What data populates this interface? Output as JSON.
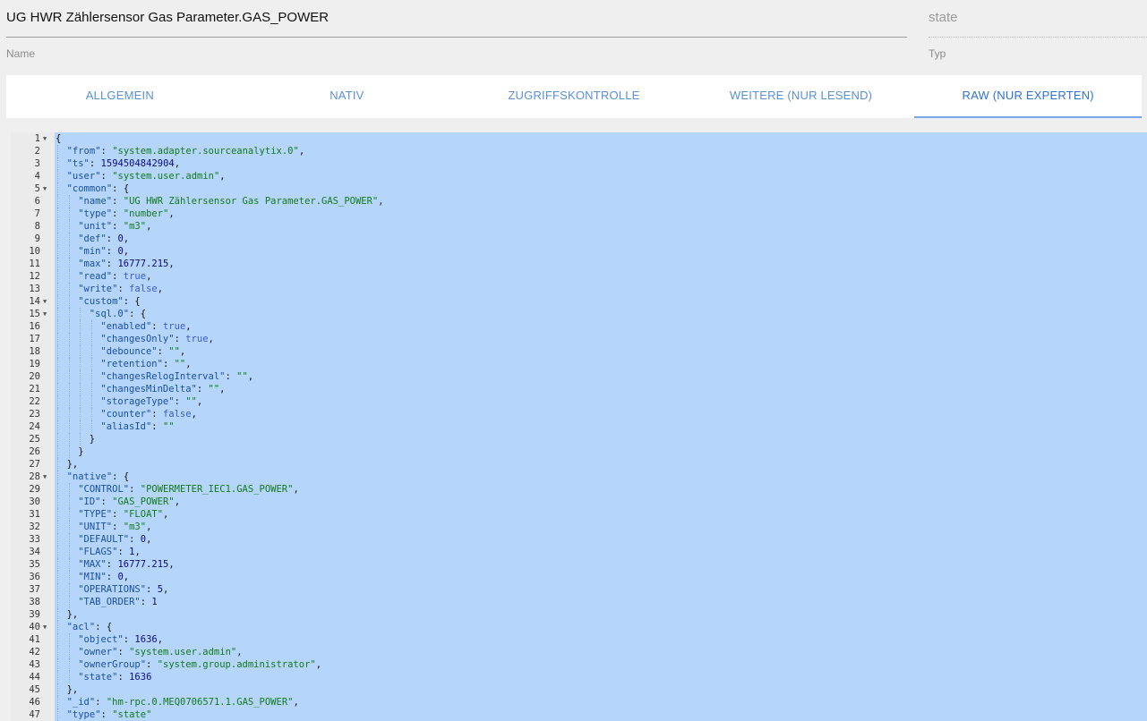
{
  "header": {
    "name_value": "UG HWR Zählersensor Gas Parameter.GAS_POWER",
    "name_label": "Name",
    "type_value": "state",
    "type_label": "Typ"
  },
  "tabs": [
    {
      "label": "ALLGEMEIN",
      "active": false
    },
    {
      "label": "NATIV",
      "active": false
    },
    {
      "label": "ZUGRIFFSKONTROLLE",
      "active": false
    },
    {
      "label": "WEITERE (NUR LESEND)",
      "active": false
    },
    {
      "label": "RAW (NUR EXPERTEN)",
      "active": true
    }
  ],
  "colors": {
    "selection": "#b5d5fb",
    "tab_text": "#5b8fd6",
    "tab_active_underline": "#7aa7e6",
    "json_key": "#1a4fa0",
    "json_string": "#117a1d",
    "json_number": "#0b0b84",
    "json_boolean": "#3a5bd6"
  },
  "editor": {
    "lines": [
      {
        "n": 1,
        "indent": 0,
        "fold": true,
        "t": [
          [
            "p",
            "{"
          ]
        ]
      },
      {
        "n": 2,
        "indent": 1,
        "t": [
          [
            "k",
            "\"from\""
          ],
          [
            "p",
            ": "
          ],
          [
            "s",
            "\"system.adapter.sourceanalytix.0\""
          ],
          [
            "p",
            ","
          ]
        ]
      },
      {
        "n": 3,
        "indent": 1,
        "t": [
          [
            "k",
            "\"ts\""
          ],
          [
            "p",
            ": "
          ],
          [
            "n",
            "1594504842904"
          ],
          [
            "p",
            ","
          ]
        ]
      },
      {
        "n": 4,
        "indent": 1,
        "t": [
          [
            "k",
            "\"user\""
          ],
          [
            "p",
            ": "
          ],
          [
            "s",
            "\"system.user.admin\""
          ],
          [
            "p",
            ","
          ]
        ]
      },
      {
        "n": 5,
        "indent": 1,
        "fold": true,
        "t": [
          [
            "k",
            "\"common\""
          ],
          [
            "p",
            ": {"
          ]
        ]
      },
      {
        "n": 6,
        "indent": 2,
        "t": [
          [
            "k",
            "\"name\""
          ],
          [
            "p",
            ": "
          ],
          [
            "s",
            "\"UG HWR Zählersensor Gas Parameter.GAS_POWER\""
          ],
          [
            "p",
            ","
          ]
        ]
      },
      {
        "n": 7,
        "indent": 2,
        "t": [
          [
            "k",
            "\"type\""
          ],
          [
            "p",
            ": "
          ],
          [
            "s",
            "\"number\""
          ],
          [
            "p",
            ","
          ]
        ]
      },
      {
        "n": 8,
        "indent": 2,
        "t": [
          [
            "k",
            "\"unit\""
          ],
          [
            "p",
            ": "
          ],
          [
            "s",
            "\"m3\""
          ],
          [
            "p",
            ","
          ]
        ]
      },
      {
        "n": 9,
        "indent": 2,
        "t": [
          [
            "k",
            "\"def\""
          ],
          [
            "p",
            ": "
          ],
          [
            "n",
            "0"
          ],
          [
            "p",
            ","
          ]
        ]
      },
      {
        "n": 10,
        "indent": 2,
        "t": [
          [
            "k",
            "\"min\""
          ],
          [
            "p",
            ": "
          ],
          [
            "n",
            "0"
          ],
          [
            "p",
            ","
          ]
        ]
      },
      {
        "n": 11,
        "indent": 2,
        "t": [
          [
            "k",
            "\"max\""
          ],
          [
            "p",
            ": "
          ],
          [
            "n",
            "16777.215"
          ],
          [
            "p",
            ","
          ]
        ]
      },
      {
        "n": 12,
        "indent": 2,
        "t": [
          [
            "k",
            "\"read\""
          ],
          [
            "p",
            ": "
          ],
          [
            "b",
            "true"
          ],
          [
            "p",
            ","
          ]
        ]
      },
      {
        "n": 13,
        "indent": 2,
        "t": [
          [
            "k",
            "\"write\""
          ],
          [
            "p",
            ": "
          ],
          [
            "b",
            "false"
          ],
          [
            "p",
            ","
          ]
        ]
      },
      {
        "n": 14,
        "indent": 2,
        "fold": true,
        "t": [
          [
            "k",
            "\"custom\""
          ],
          [
            "p",
            ": {"
          ]
        ]
      },
      {
        "n": 15,
        "indent": 3,
        "fold": true,
        "t": [
          [
            "k",
            "\"sql.0\""
          ],
          [
            "p",
            ": {"
          ]
        ]
      },
      {
        "n": 16,
        "indent": 4,
        "t": [
          [
            "k",
            "\"enabled\""
          ],
          [
            "p",
            ": "
          ],
          [
            "b",
            "true"
          ],
          [
            "p",
            ","
          ]
        ]
      },
      {
        "n": 17,
        "indent": 4,
        "t": [
          [
            "k",
            "\"changesOnly\""
          ],
          [
            "p",
            ": "
          ],
          [
            "b",
            "true"
          ],
          [
            "p",
            ","
          ]
        ]
      },
      {
        "n": 18,
        "indent": 4,
        "t": [
          [
            "k",
            "\"debounce\""
          ],
          [
            "p",
            ": "
          ],
          [
            "s",
            "\"\""
          ],
          [
            "p",
            ","
          ]
        ]
      },
      {
        "n": 19,
        "indent": 4,
        "t": [
          [
            "k",
            "\"retention\""
          ],
          [
            "p",
            ": "
          ],
          [
            "s",
            "\"\""
          ],
          [
            "p",
            ","
          ]
        ]
      },
      {
        "n": 20,
        "indent": 4,
        "t": [
          [
            "k",
            "\"changesRelogInterval\""
          ],
          [
            "p",
            ": "
          ],
          [
            "s",
            "\"\""
          ],
          [
            "p",
            ","
          ]
        ]
      },
      {
        "n": 21,
        "indent": 4,
        "t": [
          [
            "k",
            "\"changesMinDelta\""
          ],
          [
            "p",
            ": "
          ],
          [
            "s",
            "\"\""
          ],
          [
            "p",
            ","
          ]
        ]
      },
      {
        "n": 22,
        "indent": 4,
        "t": [
          [
            "k",
            "\"storageType\""
          ],
          [
            "p",
            ": "
          ],
          [
            "s",
            "\"\""
          ],
          [
            "p",
            ","
          ]
        ]
      },
      {
        "n": 23,
        "indent": 4,
        "t": [
          [
            "k",
            "\"counter\""
          ],
          [
            "p",
            ": "
          ],
          [
            "b",
            "false"
          ],
          [
            "p",
            ","
          ]
        ]
      },
      {
        "n": 24,
        "indent": 4,
        "t": [
          [
            "k",
            "\"aliasId\""
          ],
          [
            "p",
            ": "
          ],
          [
            "s",
            "\"\""
          ]
        ]
      },
      {
        "n": 25,
        "indent": 3,
        "t": [
          [
            "p",
            "}"
          ]
        ]
      },
      {
        "n": 26,
        "indent": 2,
        "t": [
          [
            "p",
            "}"
          ]
        ]
      },
      {
        "n": 27,
        "indent": 1,
        "t": [
          [
            "p",
            "},"
          ]
        ]
      },
      {
        "n": 28,
        "indent": 1,
        "fold": true,
        "t": [
          [
            "k",
            "\"native\""
          ],
          [
            "p",
            ": {"
          ]
        ]
      },
      {
        "n": 29,
        "indent": 2,
        "t": [
          [
            "k",
            "\"CONTROL\""
          ],
          [
            "p",
            ": "
          ],
          [
            "s",
            "\"POWERMETER_IEC1.GAS_POWER\""
          ],
          [
            "p",
            ","
          ]
        ]
      },
      {
        "n": 30,
        "indent": 2,
        "t": [
          [
            "k",
            "\"ID\""
          ],
          [
            "p",
            ": "
          ],
          [
            "s",
            "\"GAS_POWER\""
          ],
          [
            "p",
            ","
          ]
        ]
      },
      {
        "n": 31,
        "indent": 2,
        "t": [
          [
            "k",
            "\"TYPE\""
          ],
          [
            "p",
            ": "
          ],
          [
            "s",
            "\"FLOAT\""
          ],
          [
            "p",
            ","
          ]
        ]
      },
      {
        "n": 32,
        "indent": 2,
        "t": [
          [
            "k",
            "\"UNIT\""
          ],
          [
            "p",
            ": "
          ],
          [
            "s",
            "\"m3\""
          ],
          [
            "p",
            ","
          ]
        ]
      },
      {
        "n": 33,
        "indent": 2,
        "t": [
          [
            "k",
            "\"DEFAULT\""
          ],
          [
            "p",
            ": "
          ],
          [
            "n",
            "0"
          ],
          [
            "p",
            ","
          ]
        ]
      },
      {
        "n": 34,
        "indent": 2,
        "t": [
          [
            "k",
            "\"FLAGS\""
          ],
          [
            "p",
            ": "
          ],
          [
            "n",
            "1"
          ],
          [
            "p",
            ","
          ]
        ]
      },
      {
        "n": 35,
        "indent": 2,
        "t": [
          [
            "k",
            "\"MAX\""
          ],
          [
            "p",
            ": "
          ],
          [
            "n",
            "16777.215"
          ],
          [
            "p",
            ","
          ]
        ]
      },
      {
        "n": 36,
        "indent": 2,
        "t": [
          [
            "k",
            "\"MIN\""
          ],
          [
            "p",
            ": "
          ],
          [
            "n",
            "0"
          ],
          [
            "p",
            ","
          ]
        ]
      },
      {
        "n": 37,
        "indent": 2,
        "t": [
          [
            "k",
            "\"OPERATIONS\""
          ],
          [
            "p",
            ": "
          ],
          [
            "n",
            "5"
          ],
          [
            "p",
            ","
          ]
        ]
      },
      {
        "n": 38,
        "indent": 2,
        "t": [
          [
            "k",
            "\"TAB_ORDER\""
          ],
          [
            "p",
            ": "
          ],
          [
            "n",
            "1"
          ]
        ]
      },
      {
        "n": 39,
        "indent": 1,
        "t": [
          [
            "p",
            "},"
          ]
        ]
      },
      {
        "n": 40,
        "indent": 1,
        "fold": true,
        "t": [
          [
            "k",
            "\"acl\""
          ],
          [
            "p",
            ": {"
          ]
        ]
      },
      {
        "n": 41,
        "indent": 2,
        "t": [
          [
            "k",
            "\"object\""
          ],
          [
            "p",
            ": "
          ],
          [
            "n",
            "1636"
          ],
          [
            "p",
            ","
          ]
        ]
      },
      {
        "n": 42,
        "indent": 2,
        "t": [
          [
            "k",
            "\"owner\""
          ],
          [
            "p",
            ": "
          ],
          [
            "s",
            "\"system.user.admin\""
          ],
          [
            "p",
            ","
          ]
        ]
      },
      {
        "n": 43,
        "indent": 2,
        "t": [
          [
            "k",
            "\"ownerGroup\""
          ],
          [
            "p",
            ": "
          ],
          [
            "s",
            "\"system.group.administrator\""
          ],
          [
            "p",
            ","
          ]
        ]
      },
      {
        "n": 44,
        "indent": 2,
        "t": [
          [
            "k",
            "\"state\""
          ],
          [
            "p",
            ": "
          ],
          [
            "n",
            "1636"
          ]
        ]
      },
      {
        "n": 45,
        "indent": 1,
        "t": [
          [
            "p",
            "},"
          ]
        ]
      },
      {
        "n": 46,
        "indent": 1,
        "t": [
          [
            "k",
            "\"_id\""
          ],
          [
            "p",
            ": "
          ],
          [
            "s",
            "\"hm-rpc.0.MEQ0706571.1.GAS_POWER\""
          ],
          [
            "p",
            ","
          ]
        ]
      },
      {
        "n": 47,
        "indent": 1,
        "t": [
          [
            "k",
            "\"type\""
          ],
          [
            "p",
            ": "
          ],
          [
            "s",
            "\"state\""
          ]
        ]
      }
    ]
  }
}
